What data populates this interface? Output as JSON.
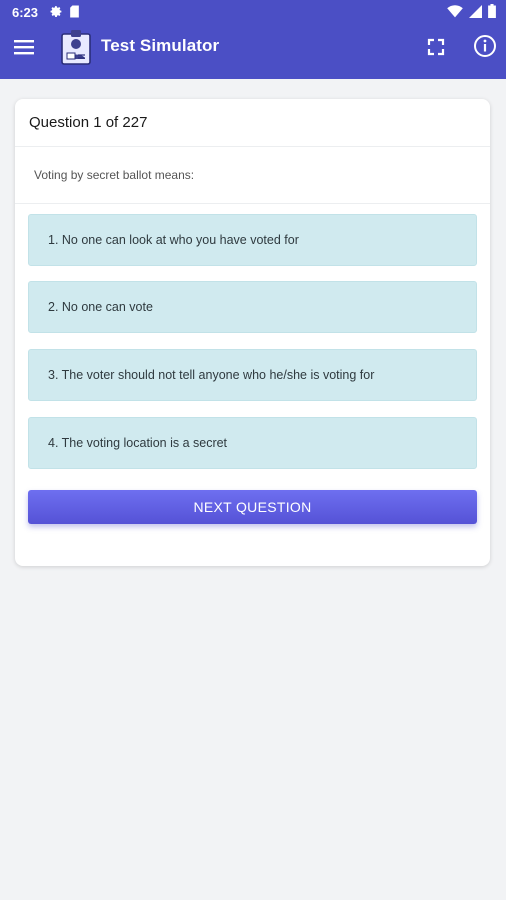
{
  "status_bar": {
    "time": "6:23",
    "icons": [
      "gear-icon",
      "sd-card-icon",
      "wifi-icon",
      "signal-icon",
      "battery-icon"
    ]
  },
  "app_bar": {
    "title": "Test Simulator",
    "icons": [
      "menu-icon",
      "id-card-logo",
      "fullscreen-icon",
      "info-icon"
    ],
    "color": "#4b4fc5"
  },
  "quiz": {
    "progress": "Question 1 of 227",
    "question": "Voting by secret ballot means:",
    "answers": [
      "1. No one can look at who you have voted for",
      "2. No one can vote",
      "3. The voter should not tell anyone who he/she is voting for",
      "4. The voting location is a secret"
    ],
    "answer_color": "#d0eaef",
    "next_button": "NEXT QUESTION",
    "next_button_color": "#5f5fe2"
  }
}
